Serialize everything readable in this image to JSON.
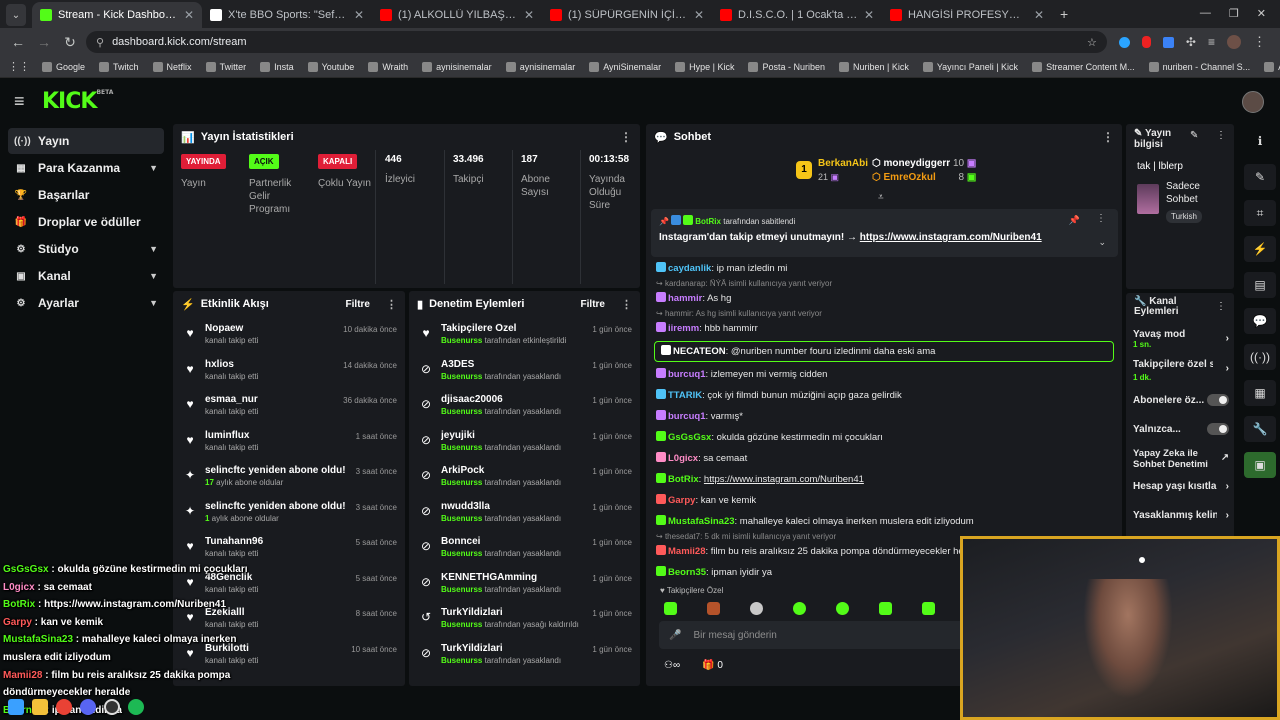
{
  "browser": {
    "tabs": [
      {
        "title": "Stream - Kick Dashboard",
        "color": "#53fc18"
      },
      {
        "title": "X'te BBO Sports: \"Sefo ve Mus",
        "color": "#ffffff"
      },
      {
        "title": "(1) ALKOLLÜ YILBAŞI PAKETLERİ",
        "color": "#ff0000"
      },
      {
        "title": "(1) SÜPÜRGENİN İÇİNE MAYTAP",
        "color": "#ff0000"
      },
      {
        "title": "D.I.S.C.O. | 1 Ocak'ta sadece sin",
        "color": "#ff0000"
      },
      {
        "title": "HANGİSİ PROFESYONEL FUTBO",
        "color": "#ff0000"
      }
    ],
    "url": "dashboard.kick.com/stream",
    "bookmarks": [
      "Google",
      "Twitch",
      "Netflix",
      "Twitter",
      "Insta",
      "Youtube",
      "Wraith",
      "aynisinemalar",
      "aynisinemalar",
      "AyniSinemalar",
      "Hype | Kick",
      "Posta - Nuriben",
      "Nuriben | Kick",
      "Yayıncı Paneli | Kick",
      "Streamer Content M...",
      "nuriben - Channel S...",
      "Aynı Sinemalar - Ça..."
    ]
  },
  "header": {
    "logo": "KICK",
    "beta": "BETA"
  },
  "sidebar": {
    "items": [
      {
        "label": "Yayın",
        "icon": "((·))"
      },
      {
        "label": "Para Kazanma",
        "icon": "▦"
      },
      {
        "label": "Başarılar",
        "icon": "🏆"
      },
      {
        "label": "Droplar ve ödüller",
        "icon": "🎁"
      },
      {
        "label": "Stüdyo",
        "icon": "⚙"
      },
      {
        "label": "Kanal",
        "icon": "▣"
      },
      {
        "label": "Ayarlar",
        "icon": "⚙"
      }
    ]
  },
  "stats": {
    "title": "Yayın İstatistikleri",
    "stream_badge": "YAYINDA",
    "stream_label": "Yayın",
    "partner_badge": "AÇIK",
    "partner_label": "Partnerlik Gelir Programı",
    "multi_badge": "KAPALI",
    "multi_label": "Çoklu Yayın",
    "viewers": "446",
    "viewers_label": "İzleyici",
    "followers": "33.496",
    "followers_label": "Takipçi",
    "subs": "187",
    "subs_label": "Abone Sayısı",
    "uptime": "00:13:58",
    "uptime_label": "Yayında Olduğu Süre"
  },
  "activity": {
    "title": "Etkinlik Akışı",
    "filter": "Filtre",
    "rows": [
      {
        "name": "Nopaew",
        "sub": "kanalı takip etti",
        "time": "10 dakika önce",
        "icon": "♥"
      },
      {
        "name": "hxlios",
        "sub": "kanalı takip etti",
        "time": "14 dakika önce",
        "icon": "♥"
      },
      {
        "name": "esmaa_nur",
        "sub": "kanalı takip etti",
        "time": "36 dakika önce",
        "icon": "♥"
      },
      {
        "name": "luminflux",
        "sub": "kanalı takip etti",
        "time": "1 saat önce",
        "icon": "♥"
      },
      {
        "name": "selincftc yeniden abone oldu!",
        "subg": "17",
        "sub": " aylık abone oldular",
        "time": "3 saat önce",
        "icon": "✦"
      },
      {
        "name": "selincftc yeniden abone oldu!",
        "subg": "1",
        "sub": " aylık abone oldular",
        "time": "3 saat önce",
        "icon": "✦"
      },
      {
        "name": "Tunahann96",
        "sub": "kanalı takip etti",
        "time": "5 saat önce",
        "icon": "♥"
      },
      {
        "name": "48Genclik",
        "sub": "kanalı takip etti",
        "time": "5 saat önce",
        "icon": "♥"
      },
      {
        "name": "Ezekialll",
        "sub": "kanalı takip etti",
        "time": "8 saat önce",
        "icon": "♥"
      },
      {
        "name": "Burkilotti",
        "sub": "kanalı takip etti",
        "time": "10 saat önce",
        "icon": "♥"
      }
    ]
  },
  "moderation": {
    "title": "Denetim Eylemleri",
    "filter": "Filtre",
    "rows": [
      {
        "name": "Takipçilere Özel",
        "subg": "Busenurss",
        "sub": " tarafından etkinleştirildi",
        "time": "1 gün önce",
        "icon": "♥"
      },
      {
        "name": "A3DES",
        "subg": "Busenurss",
        "sub": " tarafından yasaklandı",
        "time": "1 gün önce",
        "icon": "⊘"
      },
      {
        "name": "djisaac20006",
        "subg": "Busenurss",
        "sub": " tarafından yasaklandı",
        "time": "1 gün önce",
        "icon": "⊘"
      },
      {
        "name": "jeyujiki",
        "subg": "Busenurss",
        "sub": " tarafından yasaklandı",
        "time": "1 gün önce",
        "icon": "⊘"
      },
      {
        "name": "ArkiPock",
        "subg": "Busenurss",
        "sub": " tarafından yasaklandı",
        "time": "1 gün önce",
        "icon": "⊘"
      },
      {
        "name": "nwudd3lla",
        "subg": "Busenurss",
        "sub": " tarafından yasaklandı",
        "time": "1 gün önce",
        "icon": "⊘"
      },
      {
        "name": "Bonncei",
        "subg": "Busenurss",
        "sub": " tarafından yasaklandı",
        "time": "1 gün önce",
        "icon": "⊘"
      },
      {
        "name": "KENNETHGAmming",
        "subg": "Busenurss",
        "sub": " tarafından yasaklandı",
        "time": "1 gün önce",
        "icon": "⊘"
      },
      {
        "name": "TurkYildizlari",
        "subg": "Busenurss",
        "sub": " tarafından yasağı kaldırıldı",
        "time": "1 gün önce",
        "icon": "↺"
      },
      {
        "name": "TurkYildizlari",
        "subg": "Busenurss",
        "sub": " tarafından yasaklandı",
        "time": "1 gün önce",
        "icon": "⊘"
      }
    ]
  },
  "chat": {
    "title": "Sohbet",
    "top_gifter": {
      "rank": "1",
      "name": "BerkanAbi",
      "count": "21"
    },
    "gifter2": {
      "name": "moneydiggerr",
      "count": "10"
    },
    "gifter3": {
      "name": "EmreOzkul",
      "count": "8"
    },
    "pinned_by_user": "BotRix",
    "pinned_by_text": "tarafından sabitlendi",
    "pinned_text": "Instagram'dan takip etmeyi unutmayın! →",
    "pinned_link": "https://www.instagram.com/Nuriben41",
    "messages": [
      {
        "user": "caydanlik",
        "color": "#4fc3f7",
        "text": ": ip man izledin mi"
      },
      {
        "reply": "kardanarap: ÑÝÂ isimli kullanıcıya yanıt veriyor"
      },
      {
        "user": "hammir",
        "color": "#c77dff",
        "text": ": As hg"
      },
      {
        "reply": "hammir: As hg isimli kullanıcıya yanıt veriyor"
      },
      {
        "user": "iiremm",
        "color": "#c77dff",
        "text": ": hbb hammirr"
      },
      {
        "user": "NECATEON",
        "color": "#ffffff",
        "text": ": @nuriben number fouru izledinmi daha eski ama",
        "hl": true
      },
      {
        "user": "burcuq1",
        "color": "#c77dff",
        "text": ": izlemeyen mi vermiş cidden"
      },
      {
        "user": "TTARIK",
        "color": "#4fc3f7",
        "text": ": çok iyi filmdi bunun müziğini açıp gaza gelirdik"
      },
      {
        "user": "burcuq1",
        "color": "#c77dff",
        "text": ": varmış*"
      },
      {
        "user": "GsGsGsx",
        "color": "#53fc18",
        "text": ": okulda gözüne kestirmedin mi çocukları"
      },
      {
        "user": "L0gicx",
        "color": "#ff8cc6",
        "text": ": sa cemaat"
      },
      {
        "user": "BotRix",
        "color": "#53fc18",
        "text": ": ",
        "link": "https://www.instagram.com/Nuriben41"
      },
      {
        "user": "Garpy",
        "color": "#ff5a5a",
        "text": ": kan ve kemik"
      },
      {
        "user": "MustafaSina23",
        "color": "#53fc18",
        "text": ": mahalleye kaleci olmaya inerken muslera edit izliyodum"
      },
      {
        "reply": "thesedat7: 5 dk mi isimli kullanıcıya yanıt veriyor"
      },
      {
        "user": "Mamii28",
        "color": "#ff5a5a",
        "text": ": film bu reis aralıksız 25 dakika pompa döndürmeyecekler herald"
      },
      {
        "user": "Beorn35",
        "color": "#53fc18",
        "text": ": ipman iyidir ya"
      }
    ],
    "mode": "Takipçilere Özel",
    "placeholder": "Bir mesaj gönderin",
    "count": "0"
  },
  "stream_info": {
    "title": "Yayın bilgisi",
    "stream_title": "tak | lblerp",
    "category": "Sadece Sohbet",
    "language": "Turkish"
  },
  "channel_actions": {
    "title": "Kanal Eylemleri",
    "slow_mode": "Yavaş mod",
    "slow_value": "1 sn.",
    "followers_only": "Takipçilere özel s",
    "followers_value": "1 dk.",
    "subs_only": "Abonelere öz...",
    "emote_only": "Yalnızca...",
    "ai_mod": "Yapay Zeka ile Sohbet Denetimi",
    "age": "Hesap yaşı kısıtla",
    "banned_words": "Yasaklanmış kelin"
  },
  "overlay": {
    "lines": [
      {
        "user": "GsGsGsx",
        "color": "#53fc18",
        "text": " : okulda gözüne kestirmedin mi çocukları"
      },
      {
        "user": "L0gicx",
        "color": "#ff8cc6",
        "text": " : sa cemaat"
      },
      {
        "user": "BotRix",
        "color": "#53fc18",
        "text": " : https://www.instagram.com/Nuriben41"
      },
      {
        "user": "Garpy",
        "color": "#ff5a5a",
        "text": " : kan ve kemik"
      },
      {
        "user": "MustafaSina23",
        "color": "#53fc18",
        "text": " : mahalleye kaleci olmaya inerken"
      },
      {
        "user": "",
        "color": "#ffffff",
        "text": "muslera edit izliyodum"
      },
      {
        "user": "Mamii28",
        "color": "#ff5a5a",
        "text": " : film bu reis aralıksız 25 dakika pompa"
      },
      {
        "user": "",
        "color": "#ffffff",
        "text": "döndürmeyecekler heralde"
      },
      {
        "user": "Beorn35",
        "color": "#53fc18",
        "text": " : ipman iyidir ya"
      }
    ]
  }
}
